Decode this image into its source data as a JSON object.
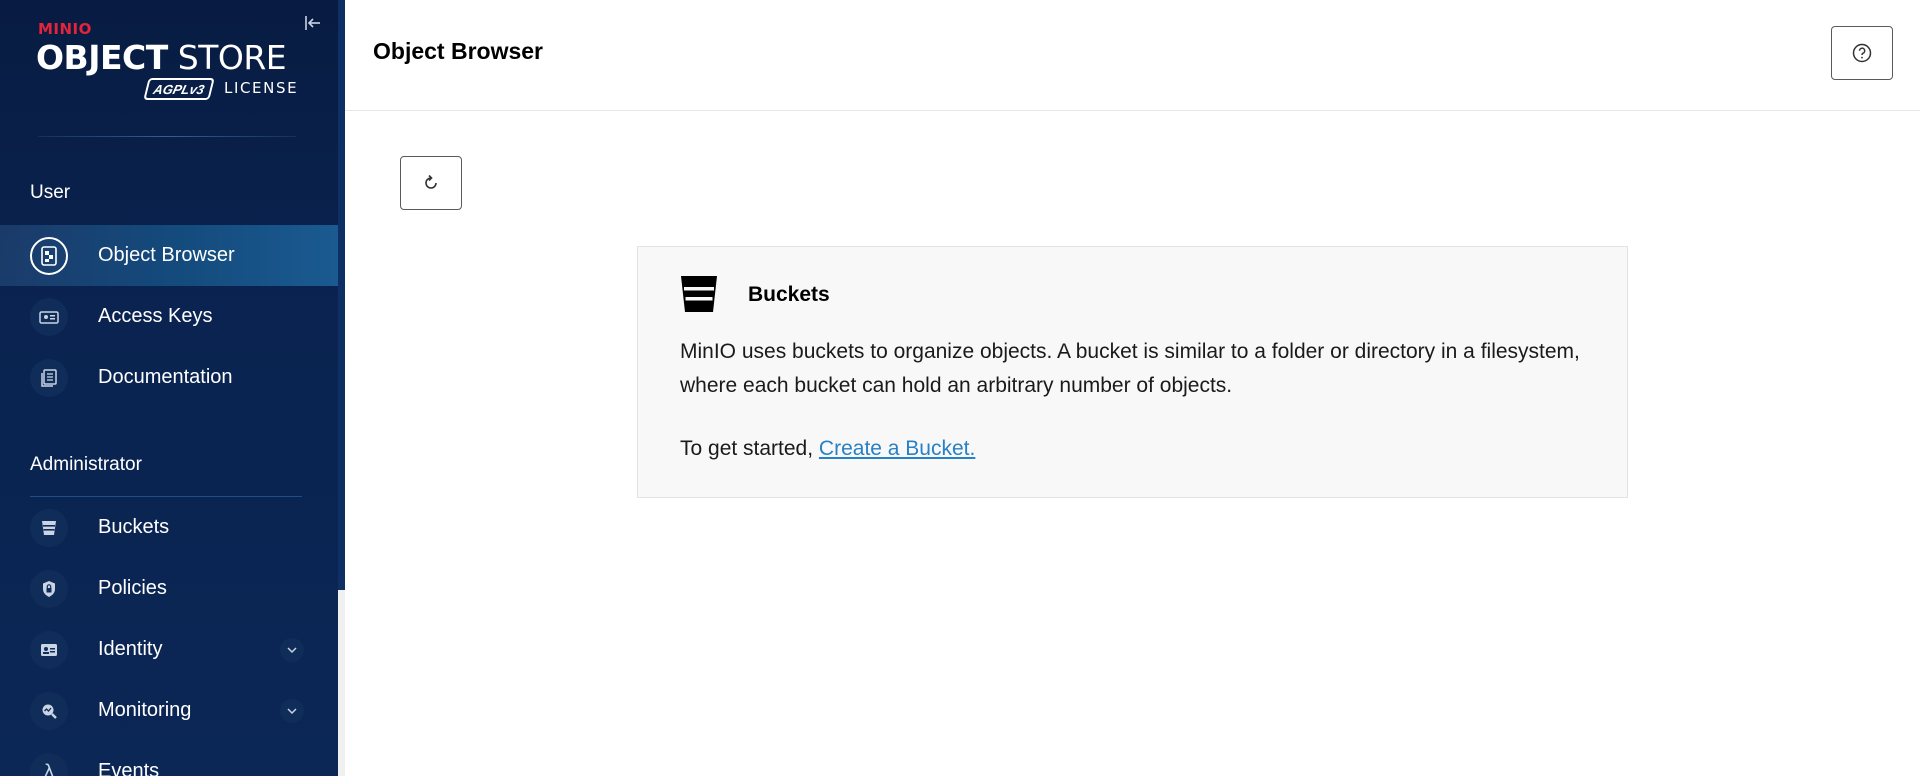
{
  "sidebar": {
    "logo": {
      "brand": "MINIO",
      "product_bold": "OBJECT",
      "product_light": "STORE",
      "badge": "AGPLv3",
      "license": "LICENSE"
    },
    "sections": {
      "user": "User",
      "admin": "Administrator"
    },
    "items": [
      {
        "label": "Object Browser",
        "icon": "object-browser-icon",
        "active": true
      },
      {
        "label": "Access Keys",
        "icon": "access-keys-icon"
      },
      {
        "label": "Documentation",
        "icon": "documentation-icon"
      },
      {
        "label": "Buckets",
        "icon": "bucket-icon"
      },
      {
        "label": "Policies",
        "icon": "policies-icon"
      },
      {
        "label": "Identity",
        "icon": "identity-icon",
        "expandable": true
      },
      {
        "label": "Monitoring",
        "icon": "monitoring-icon",
        "expandable": true
      },
      {
        "label": "Events",
        "icon": "lambda-icon"
      }
    ]
  },
  "header": {
    "title": "Object Browser"
  },
  "card": {
    "title": "Buckets",
    "description": "MinIO uses buckets to organize objects. A bucket is similar to a folder or directory in a filesystem, where each bucket can hold an arbitrary number of objects.",
    "cta_prefix": "To get started,",
    "cta_link": "Create a Bucket."
  },
  "colors": {
    "sidebar_bg": "#0a2350",
    "link": "#2781c6",
    "brand_red": "#e3243b"
  }
}
